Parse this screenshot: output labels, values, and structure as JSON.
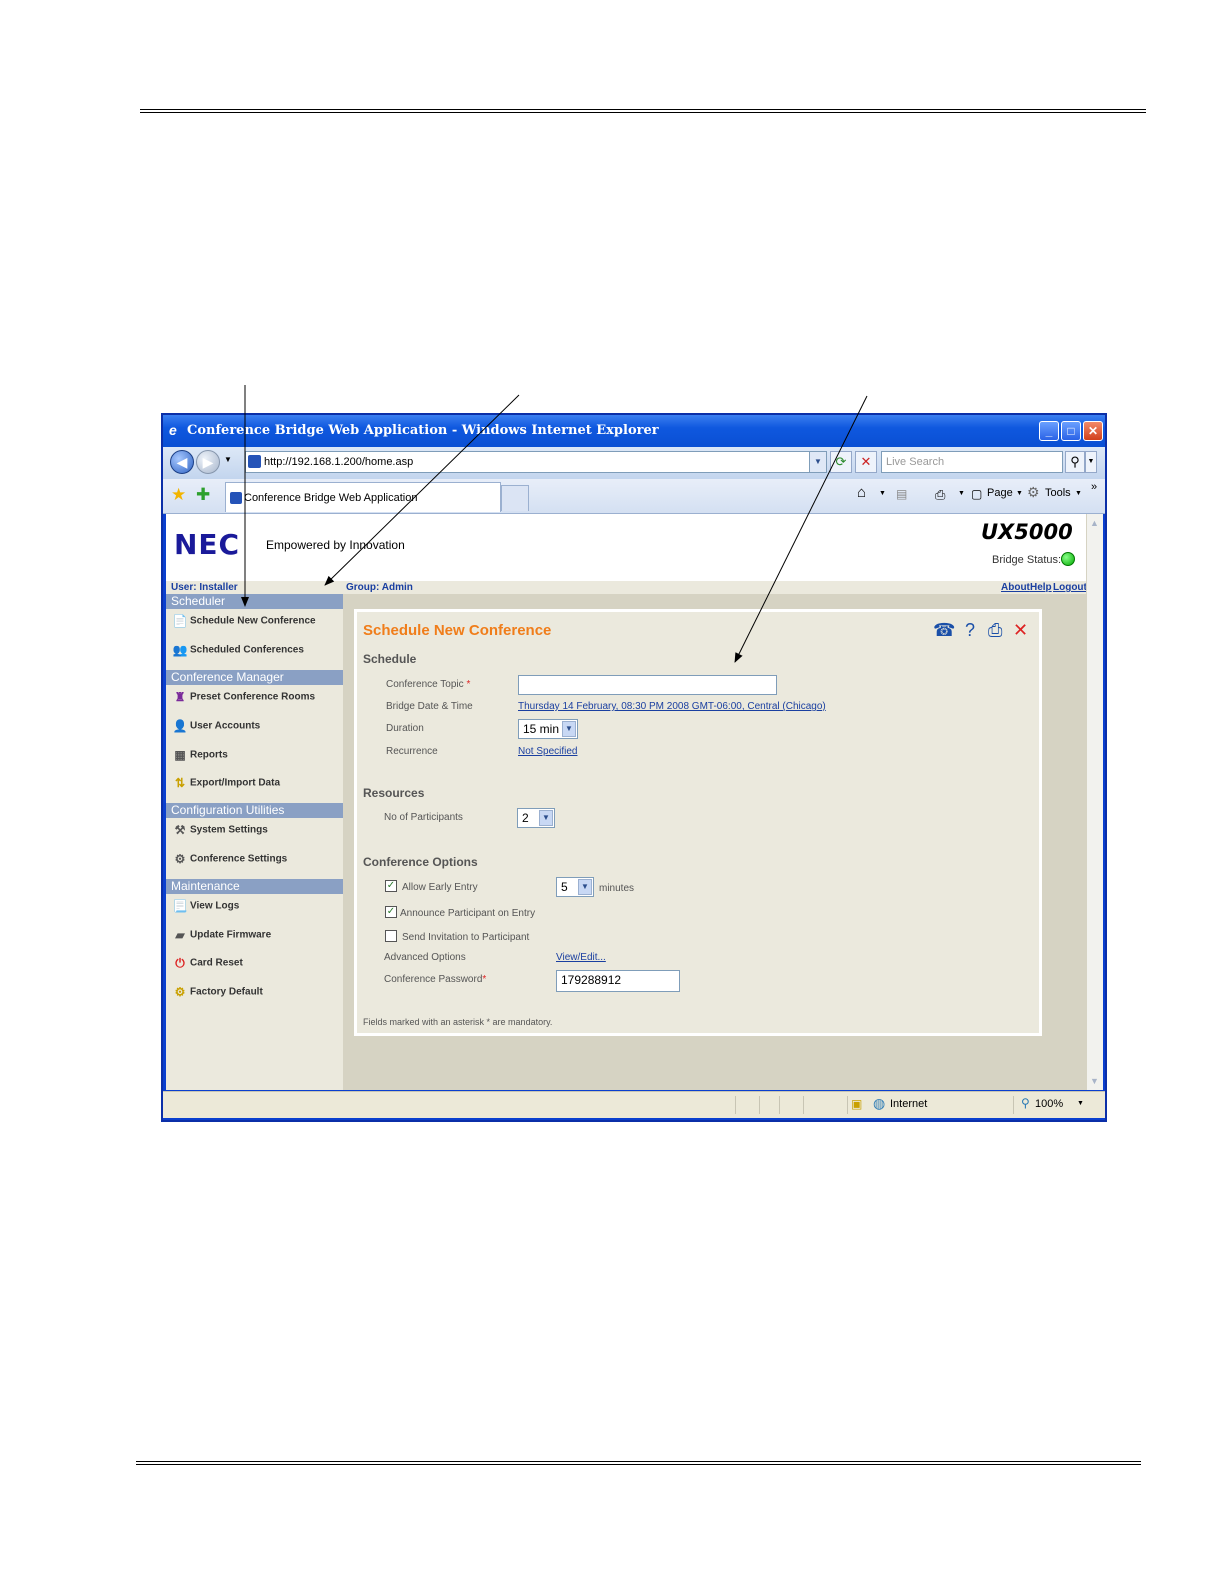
{
  "window": {
    "title": "Conference Bridge Web Application - Windows Internet Explorer"
  },
  "navbar": {
    "url": "http://192.168.1.200/home.asp",
    "search_placeholder": "Live Search"
  },
  "tabs": {
    "active_label": "Conference Bridge Web Application"
  },
  "commandbar": {
    "page_label": "Page",
    "tools_label": "Tools"
  },
  "header": {
    "logo": "NEC",
    "tagline": "Empowered by Innovation",
    "product": "UX5000",
    "bridge_status_label": "Bridge Status:",
    "bridge_status_color": "#00cc00"
  },
  "infobar": {
    "user": "User: Installer",
    "group": "Group: Admin",
    "about": "About",
    "help": "Help",
    "logout": "Logout"
  },
  "sidebar": {
    "sections": [
      {
        "title": "Scheduler",
        "items": [
          {
            "label": "Schedule New Conference",
            "icon": "schedule-icon"
          },
          {
            "label": "Scheduled Conferences",
            "icon": "conferences-icon"
          }
        ]
      },
      {
        "title": "Conference Manager",
        "items": [
          {
            "label": "Preset Conference Rooms",
            "icon": "rooms-icon"
          },
          {
            "label": "User Accounts",
            "icon": "users-icon"
          },
          {
            "label": "Reports",
            "icon": "reports-icon"
          },
          {
            "label": "Export/Import Data",
            "icon": "export-icon"
          }
        ]
      },
      {
        "title": "Configuration Utilities",
        "items": [
          {
            "label": "System Settings",
            "icon": "tools-icon"
          },
          {
            "label": "Conference Settings",
            "icon": "gears-icon"
          }
        ]
      },
      {
        "title": "Maintenance",
        "items": [
          {
            "label": "View Logs",
            "icon": "logs-icon"
          },
          {
            "label": "Update Firmware",
            "icon": "firmware-icon"
          },
          {
            "label": "Card Reset",
            "icon": "power-icon"
          },
          {
            "label": "Factory Default",
            "icon": "factory-icon"
          }
        ]
      }
    ]
  },
  "form": {
    "title": "Schedule New Conference",
    "schedule_heading": "Schedule",
    "topic_label": "Conference Topic",
    "topic_value": "",
    "date_label": "Bridge Date & Time",
    "date_value": "Thursday 14 February, 08:30 PM 2008 GMT-06:00, Central (Chicago)",
    "duration_label": "Duration",
    "duration_value": "15 min",
    "recurrence_label": "Recurrence",
    "recurrence_value": "Not Specified",
    "resources_heading": "Resources",
    "participants_label": "No of Participants",
    "participants_value": "2",
    "options_heading": "Conference Options",
    "early_entry_label": "Allow Early Entry",
    "early_entry_value": "5",
    "early_entry_unit": "minutes",
    "announce_label": "Announce Participant on Entry",
    "invite_label": "Send Invitation to Participant",
    "advanced_label": "Advanced Options",
    "advanced_link": "View/Edit...",
    "password_label": "Conference Password",
    "password_value": "179288912",
    "footnote": "Fields marked with an asterisk * are mandatory.",
    "asterisk": "*"
  },
  "statusbar": {
    "zone": "Internet",
    "zoom": "100%"
  }
}
